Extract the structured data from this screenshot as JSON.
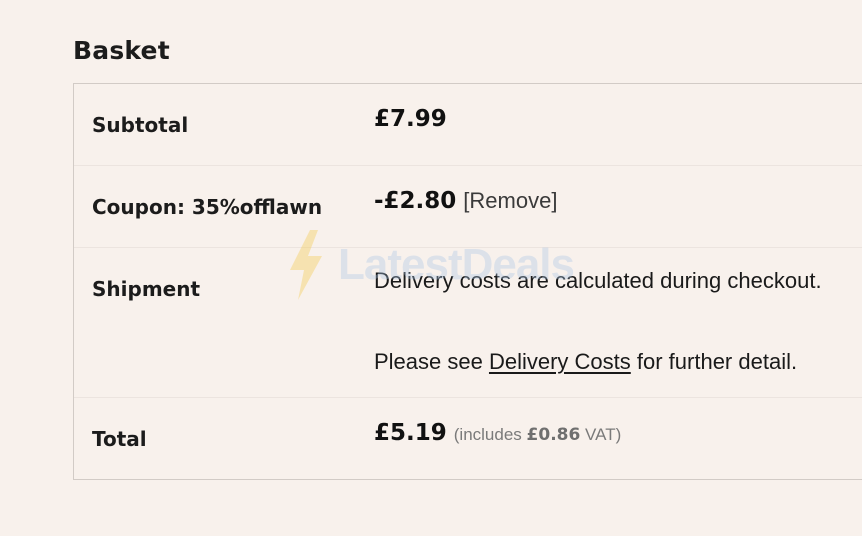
{
  "basket": {
    "title": "Basket",
    "rows": {
      "subtotal": {
        "label": "Subtotal",
        "amount": "£7.99"
      },
      "coupon": {
        "label": "Coupon: 35%offlawn",
        "amount": "-£2.80",
        "remove_label": "[Remove]"
      },
      "shipment": {
        "label": "Shipment",
        "line1": "Delivery costs are calculated during checkout.",
        "line2_prefix": "Please see ",
        "line2_link": "Delivery Costs",
        "line2_suffix": " for further detail."
      },
      "total": {
        "label": "Total",
        "amount": "£5.19",
        "vat_prefix": "(includes ",
        "vat_amount": "£0.86",
        "vat_suffix": " VAT)"
      }
    }
  },
  "watermark": {
    "text": "LatestDeals",
    "icon": "lightning-bolt-icon",
    "color": "#f5c842"
  }
}
